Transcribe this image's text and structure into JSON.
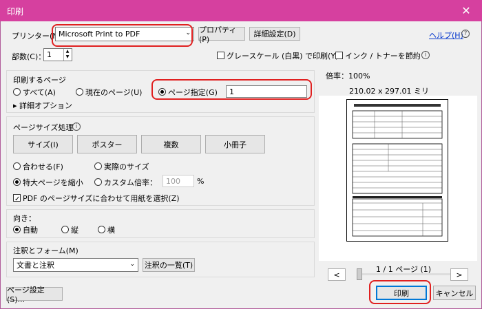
{
  "window": {
    "title": "印刷",
    "close_label": "✕"
  },
  "printer": {
    "label": "プリンター(N)：",
    "selected": "Microsoft Print to PDF",
    "properties_button": "プロパティ(P)",
    "advanced_button": "詳細設定(D)",
    "help_link": "ヘルプ(H)",
    "help_icon": "?"
  },
  "copies": {
    "label": "部数(C)：",
    "value": "1"
  },
  "options": {
    "grayscale": "グレースケール (白黒) で印刷(Y)",
    "save_ink": "インク / トナーを節約",
    "info_icon": "i"
  },
  "pages": {
    "heading": "印刷するページ",
    "all": "すべて(A)",
    "current": "現在のページ(U)",
    "range": "ページ指定(G)",
    "range_value": "1",
    "more_options": "▸ 詳細オプション"
  },
  "page_size": {
    "heading": "ページサイズ処理",
    "info_icon": "i",
    "size_button": "サイズ(I)",
    "poster_button": "ポスター",
    "multiple_button": "複数",
    "booklet_button": "小冊子",
    "fit": "合わせる(F)",
    "actual": "実際のサイズ",
    "shrink": "特大ページを縮小",
    "custom": "カスタム倍率：",
    "custom_value": "100",
    "percent": "%",
    "pdf_paper": "PDF のページサイズに合わせて用紙を選択(Z)"
  },
  "orientation": {
    "heading": "向き：",
    "auto": "自動",
    "portrait": "縦",
    "landscape": "横"
  },
  "annotations": {
    "heading": "注釈とフォーム(M)",
    "selected": "文書と注釈",
    "list_button": "注釈の一覧(T)"
  },
  "preview": {
    "scale": "倍率：100%",
    "dimensions": "210.02 x 297.01 ミリ",
    "prev": "<",
    "next": ">",
    "page_count": "1 / 1 ページ (1)"
  },
  "footer": {
    "page_setup": "ページ設定(S)...",
    "print": "印刷",
    "cancel": "キャンセル"
  }
}
